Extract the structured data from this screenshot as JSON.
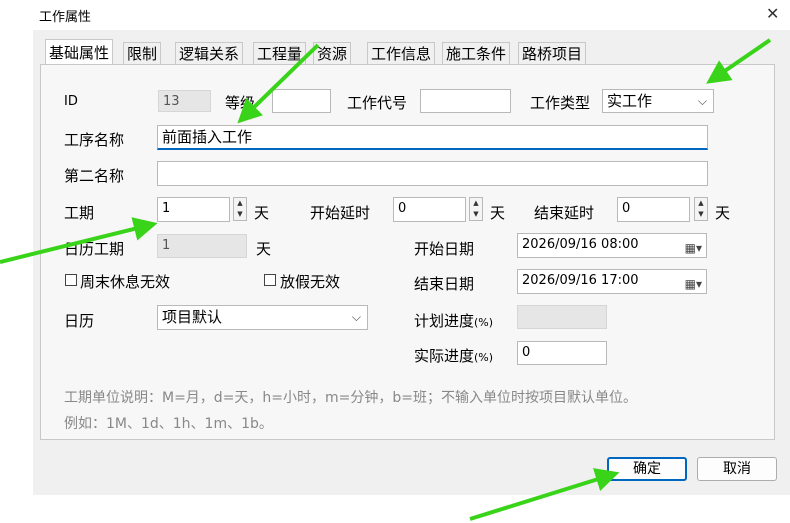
{
  "window": {
    "title": "工作属性"
  },
  "tabs": [
    "基础属性",
    "限制",
    "逻辑关系",
    "工程量",
    "资源",
    "工作信息",
    "施工条件",
    "路桥项目"
  ],
  "form": {
    "id_label": "ID",
    "id_value": "13",
    "grade_label": "等级",
    "grade_value": "",
    "code_label": "工作代号",
    "code_value": "",
    "type_label": "工作类型",
    "type_value": "实工作",
    "name_label": "工序名称",
    "name_value": "前面插入工作",
    "second_name_label": "第二名称",
    "second_name_value": "",
    "duration_label": "工期",
    "duration_value": "1",
    "unit_day": "天",
    "start_delay_label": "开始延时",
    "start_delay_value": "0",
    "end_delay_label": "结束延时",
    "end_delay_value": "0",
    "calendar_duration_label": "日历工期",
    "calendar_duration_value": "1",
    "start_date_label": "开始日期",
    "start_date_value": "2026/09/16 08:00",
    "end_date_label": "结束日期",
    "end_date_value": "2026/09/16 17:00",
    "weekend_label": "周末休息无效",
    "holiday_label": "放假无效",
    "calendar_label": "日历",
    "calendar_value": "项目默认",
    "planned_progress_label": "计划进度",
    "percent_unit": "(%)",
    "planned_progress_value": "",
    "actual_progress_label": "实际进度",
    "actual_progress_value": "0",
    "note_line1": "工期单位说明：M=月，d=天，h=小时，m=分钟，b=班；不输入单位时按项目默认单位。",
    "note_line2": "例如：1M、1d、1h、1m、1b。"
  },
  "buttons": {
    "ok": "确定",
    "cancel": "取消"
  },
  "colors": {
    "accent": "#0067c0",
    "arrow": "#39d41a"
  }
}
